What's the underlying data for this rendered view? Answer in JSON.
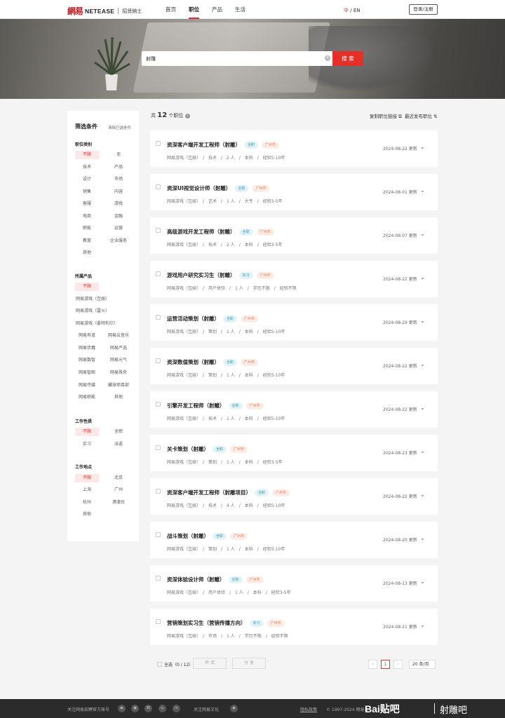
{
  "header": {
    "logo_mark": "網易",
    "logo_name": "NETEASE",
    "logo_sub": "招贤納士",
    "nav": [
      "首页",
      "职位",
      "产品",
      "生活"
    ],
    "active_nav": "职位",
    "lang_cur": "中",
    "lang_sep": " / ",
    "lang_other": "EN",
    "login": "登录/注册"
  },
  "search": {
    "value": "射雕",
    "clear": "×",
    "button": "搜 索"
  },
  "filters": {
    "title": "筛选条件",
    "clear": "清除已选条件",
    "category_title": "职位类别",
    "categories": [
      "不限",
      "无",
      "技术",
      "产品",
      "设计",
      "市场",
      "销售",
      "内容",
      "客服",
      "游戏",
      "电商",
      "金融",
      "职能",
      "运营",
      "教育",
      "企业服务",
      "其他"
    ],
    "product_title": "所属产品",
    "products": [
      "不限",
      "网易游戏（互娱）",
      "网易游戏（雷火）",
      "网易游戏（委特利尔）",
      "网易有道",
      "网易云音乐",
      "网易伏羲",
      "网易严选",
      "网易数智",
      "网易元气",
      "网易智邮",
      "网易殊央",
      "网易传媒",
      "藏球项目部",
      "网易职能",
      "其他"
    ],
    "nature_title": "工作性质",
    "natures": [
      "不限",
      "全职",
      "实习",
      "派遣"
    ],
    "location_title": "工作地点",
    "locations": [
      "不限",
      "北京",
      "上海",
      "广州",
      "杭州",
      "港澳台",
      "其他"
    ]
  },
  "list": {
    "count_prefix": "共",
    "count": "12",
    "count_suffix": "个职位",
    "info": "i",
    "copy_link": "复制职位链接 ⧉",
    "sort": "最近发布职位 ⇅"
  },
  "jobs": [
    {
      "title": "资深客户端开发工程师（射雕）",
      "type": "全职",
      "city": "广州市",
      "meta": "网易游戏（互娱）　/　技术　/　2 人　/　本科　/　经验5-10年",
      "date": "2024-08-22 更新"
    },
    {
      "title": "资深UI视觉设计师（射雕）",
      "type": "全职",
      "city": "广州市",
      "meta": "网易游戏（互娱）　/　艺术　/　1 人　/　大专　/　经验3-5年",
      "date": "2024-08-01 更新"
    },
    {
      "title": "高级游戏开发工程师（射雕）",
      "type": "全职",
      "city": "广州市",
      "meta": "网易游戏（互娱）　/　技术　/　2 人　/　本科　/　经验3-5年",
      "date": "2024-08-07 更新"
    },
    {
      "title": "游戏用户研究实习生（射雕）",
      "type": "实习",
      "city": "广州市",
      "meta": "网易游戏（互娱）　/　用户体验　/　1 人　/　学历不限　/　经验不限",
      "date": "2024-08-22 更新"
    },
    {
      "title": "运营活动策划（射雕）",
      "type": "全职",
      "city": "广州市",
      "meta": "网易游戏（互娱）　/　策划　/　1 人　/　本科　/　经验5-10年",
      "date": "2024-08-29 更新"
    },
    {
      "title": "资深数值策划（射雕）",
      "type": "全职",
      "city": "广州市",
      "meta": "网易游戏（互娱）　/　策划　/　1 人　/　本科　/　经验5-10年",
      "date": "2024-08-22 更新"
    },
    {
      "title": "引擎开发工程师（射雕）",
      "type": "全职",
      "city": "广州市",
      "meta": "网易游戏（互娱）　/　技术　/　1 人　/　本科　/　经验5-10年",
      "date": "2024-08-22 更新"
    },
    {
      "title": "关卡策划（射雕）",
      "type": "全职",
      "city": "广州市",
      "meta": "网易游戏（互娱）　/　策划　/　1 人　/　本科　/　经验3-5年",
      "date": "2024-08-23 更新"
    },
    {
      "title": "资深客户端开发工程师（射雕项目）",
      "type": "全职",
      "city": "广州市",
      "meta": "网易游戏（互娱）　/　技术　/　4 人　/　本科　/　经验5-10年",
      "date": "2024-08-22 更新"
    },
    {
      "title": "战斗策划（射雕）",
      "type": "全职",
      "city": "广州市",
      "meta": "网易游戏（互娱）　/　策划　/　1 人　/　本科　/　经验5-10年",
      "date": "2024-08-20 更新"
    },
    {
      "title": "资深体验设计师（射雕）",
      "type": "全职",
      "city": "广州市",
      "meta": "网易游戏（互娱）　/　用户体验　/　1 人　/　本科　/　经验3-5年",
      "date": "2024-08-13 更新"
    },
    {
      "title": "营销策划实习生（营销传播方向）",
      "type": "实习",
      "city": "广州市",
      "meta": "网易游戏（互娱）　/　市场　/　1 人　/　学历不限　/　经验不限",
      "date": "2024-08-21 更新"
    }
  ],
  "bottom": {
    "select_all": "全选（0 / 12）",
    "apply": "申 请",
    "share": "分 享",
    "prev": "‹",
    "page": "1",
    "next": "›",
    "page_size": "20 条/页"
  },
  "footer": {
    "follow": "关注网易招聘官方账号",
    "culture": "关注网易文化",
    "privacy": "隐私政策",
    "copyright": "© 1997-2024 网易公",
    "baidu": "Bai贴吧",
    "tieba": "射雕吧",
    "social_icons": [
      "wechat-icon",
      "bilibili-icon",
      "zhihu-icon",
      "weibo-icon",
      "linkedin-icon"
    ]
  }
}
